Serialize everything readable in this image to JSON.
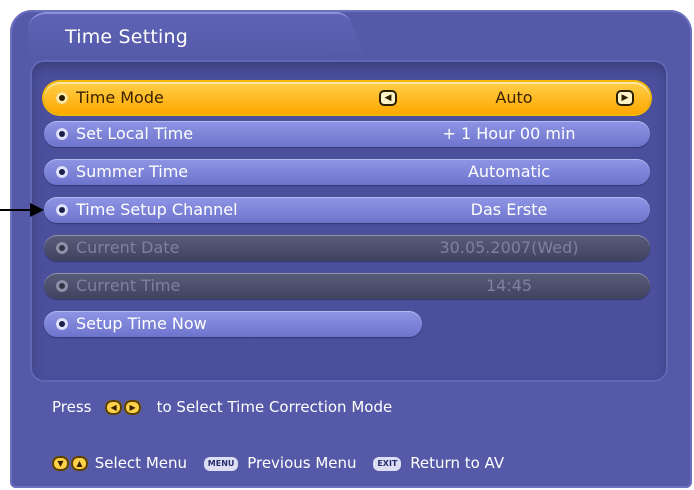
{
  "window": {
    "title": "Time Setting"
  },
  "menu": {
    "items": [
      {
        "label": "Time Mode",
        "value": "Auto",
        "state": "selected"
      },
      {
        "label": "Set Local Time",
        "value": "+ 1 Hour 00 min",
        "state": "normal"
      },
      {
        "label": "Summer Time",
        "value": "Automatic",
        "state": "normal"
      },
      {
        "label": "Time Setup Channel",
        "value": "Das Erste",
        "state": "normal"
      },
      {
        "label": "Current Date",
        "value": "30.05.2007(Wed)",
        "state": "disabled"
      },
      {
        "label": "Current Time",
        "value": "14:45",
        "state": "disabled"
      },
      {
        "label": "Setup Time Now",
        "value": "",
        "state": "normal"
      }
    ]
  },
  "hint": {
    "prefix": "Press",
    "text": "to Select Time Correction Mode"
  },
  "footer": {
    "select_label": "Select Menu",
    "menu_key": "MENU",
    "menu_label": "Previous Menu",
    "exit_key": "EXIT",
    "exit_label": "Return to AV"
  },
  "colors": {
    "panel": "#5559a8",
    "row": "#7d84dc",
    "selected": "#ffb41a",
    "disabled": "#4a4e6c"
  },
  "icons": [
    "left-arrow-key-icon",
    "right-arrow-key-icon",
    "down-arrow-key-icon",
    "up-arrow-key-icon",
    "bullet-icon",
    "pointer-arrow-icon"
  ]
}
